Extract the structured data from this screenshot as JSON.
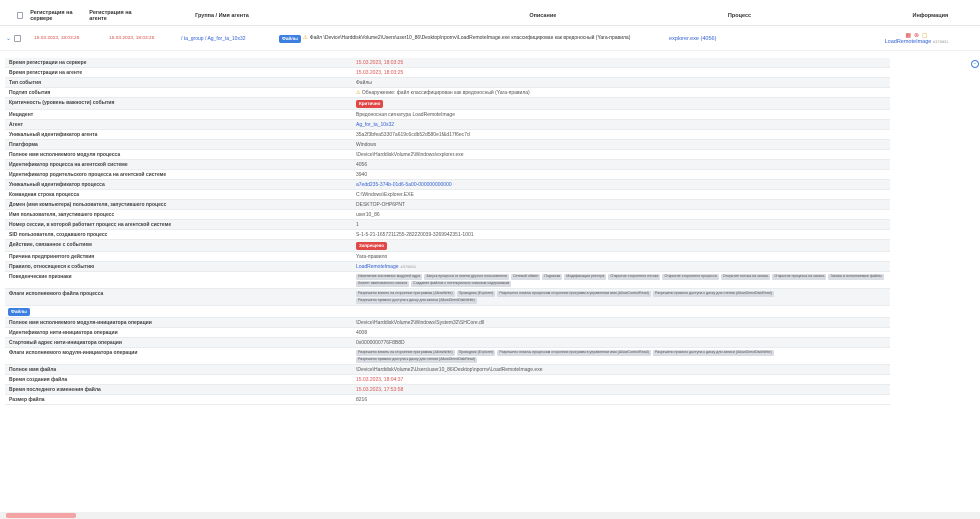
{
  "header": {
    "col_server_reg": "Регистрация на сервере",
    "col_agent_reg": "Регистрация на агенте",
    "col_group": "Группа / Имя агента",
    "col_description": "Описание",
    "col_process": "Процесс",
    "col_info": "Информация"
  },
  "event": {
    "server_time": "15.03.2023, 18:03:25",
    "agent_time": "15.03.2023, 18:03:25",
    "group_agent": "/ ta_group / Ag_for_ta_10x32",
    "type_badge": "Файлы",
    "description": "Файл \\Device\\HarddiskVolume2\\Users\\user10_86\\Desktop\\npornv\\LoadRemoteImage.exe классифицирован как вредоносный (Yara-правила)",
    "process": "explorer.exe (4056)",
    "info_link": "LoadRemoteImage",
    "info_id": "#375831"
  },
  "details": [
    {
      "label": "Время регистрации на сервере",
      "value": "15.03.2023, 18:03:25",
      "style": "red"
    },
    {
      "label": "Время регистрации на агенте",
      "value": "15.03.2023, 18:03:25",
      "style": "red"
    },
    {
      "label": "Тип события",
      "value": "Файлы"
    },
    {
      "label": "Подтип события",
      "value": "Обнаружение: файл классифицирован как вредоносный (Yara-правила)",
      "style": "warn"
    },
    {
      "label": "Критичность (уровень важности) события",
      "value": "Критично",
      "style": "badge"
    },
    {
      "label": "Инцидент",
      "value": "Вредоносная сигнатура LoadRemoteImage"
    },
    {
      "label": "Агент",
      "value": "Ag_for_ta_10x32",
      "style": "link"
    },
    {
      "label": "Уникальный идентификатор агента",
      "value": "35a2f3bfea53307a619c6cdb52d580e1f&d17f6ec7d"
    },
    {
      "label": "Платформа",
      "value": "Windows"
    },
    {
      "label": "Полное имя исполняемого модуля процесса",
      "value": "\\Device\\HarddiskVolume2\\Windows\\explorer.exe"
    },
    {
      "label": "Идентификатор процесса на агентской системе",
      "value": "4056"
    },
    {
      "label": "Идентификатор родительского процесса на агентской системе",
      "value": "3940"
    },
    {
      "label": "Уникальный идентификатор процесса",
      "value": "a7edd235-374b-01d6-5a00-000000000000",
      "style": "link"
    },
    {
      "label": "Командная строка процесса",
      "value": "C:\\Windows\\Explorer.EXE"
    },
    {
      "label": "Домен (имя компьютера) пользователя, запустившего процесс",
      "value": "DESKTOP-OHP6PNT"
    },
    {
      "label": "Имя пользователя, запустившего процесс",
      "value": "user10_86"
    },
    {
      "label": "Номер сессии, в которой работает процесс на агентской системе",
      "value": "1"
    },
    {
      "label": "SID пользователя, создавшего процесс",
      "value": "S-1-5-21-1657211255-282220039-3269942351-1001"
    },
    {
      "label": "Действие, связанное с событием",
      "value": "Запрещено",
      "style": "badge"
    },
    {
      "label": "Причина предпринятого действия",
      "value": "Yara-правило"
    },
    {
      "label": "Правило, относящееся к событию",
      "value": "LoadRemoteImage",
      "id": "#375831",
      "style": "link"
    },
    {
      "label": "Поведенческие признаки",
      "style": "tags",
      "tags": [
        "Изменение системных модулей ядра",
        "Запуск процесса от имени другого пользователя",
        "Сетевой обмен",
        "Подписки",
        "Модификация реестра",
        "Открытие стороннего потока",
        "Открытие стороннего процесса",
        "Открытие потока на запись",
        "Открытие процесса на запись",
        "Запись в исполняемые файлы",
        "Клиент именованного канала",
        "Создание файлов с потенциально опасным содержимым"
      ]
    },
    {
      "label": "Флаги исполняемого файла процесса",
      "style": "tags",
      "tags": [
        "Разрешено влиять на сторонние программы (AllowWrite)",
        "Проводник (Explorer)",
        "Разрешено помочь процессам сторонних программ в управлении ими (AllowControlRead)",
        "Разрешено прямого доступа к диску для чтения (AllowDirectDiskRead)",
        "Разрешено прямого доступа к диску для записи (AllowDirectDiskWrite)"
      ]
    },
    {
      "separator": true,
      "badge": "Файлы"
    },
    {
      "label": "Полное имя исполняемого модуля-инициатора операции",
      "value": "\\Device\\HarddiskVolume2\\Windows\\System32\\SHCore.dll"
    },
    {
      "label": "Идентификатор нити-инициатора операции",
      "value": "4008"
    },
    {
      "label": "Стартовый адрес нити-инициатора операции",
      "value": "0x0000000776F8B8D"
    },
    {
      "label": "Флаги исполняемого модуля-инициатора операции",
      "style": "tags",
      "tags": [
        "Разрешено влиять на сторонние программы (AllowWrite)",
        "Проводник (Explorer)",
        "Разрешено помочь процессам сторонних программ в управлении ими (AllowControlRead)",
        "Разрешено прямого доступа к диску для записи (AllowDirectDiskWrite)",
        "Разрешено прямого доступа к диску для чтения (AllowDirectDiskRead)"
      ]
    },
    {
      "label": "Полное имя файла",
      "value": "\\Device\\HarddiskVolume2\\Users\\user10_86\\Desktop\\npornv\\LoadRemoteImage.exe"
    },
    {
      "label": "Время создания файла",
      "value": "15.03.2023, 18:04:37",
      "style": "red"
    },
    {
      "label": "Время последнего изменения файла",
      "value": "15.03.2023, 17:53:58",
      "style": "red"
    },
    {
      "label": "Размер файла",
      "value": "8216"
    }
  ],
  "colors": {
    "accent": "#3d7fe0",
    "danger": "#e04848",
    "warning": "#e8a317"
  }
}
